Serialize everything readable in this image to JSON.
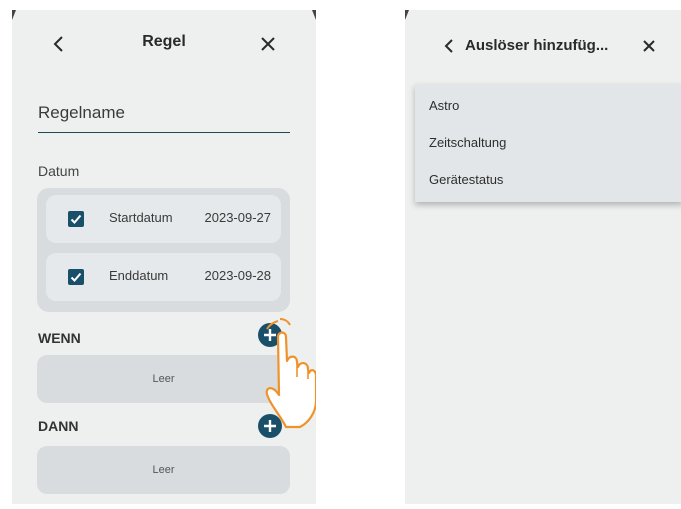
{
  "left_screen": {
    "title": "Regel",
    "rule_name_label": "Regelname",
    "date_section_label": "Datum",
    "start_date": {
      "label": "Startdatum",
      "value": "2023-09-27",
      "checked": true
    },
    "end_date": {
      "label": "Enddatum",
      "value": "2023-09-28",
      "checked": true
    },
    "when_label": "WENN",
    "when_empty": "Leer",
    "then_label": "DANN",
    "then_empty": "Leer",
    "icons": {
      "back": "chevron-left-icon",
      "close": "close-icon",
      "add": "plus-circle-icon",
      "check": "checkmark-icon",
      "tap_hand": "hand-pointer-icon"
    }
  },
  "right_screen": {
    "title": "Auslöser hinzufüg...",
    "menu_items": [
      "Astro",
      "Zeitschaltung",
      "Gerätestatus"
    ],
    "icons": {
      "back": "chevron-left-icon",
      "close": "close-icon"
    }
  },
  "colors": {
    "accent": "#1a4f6a",
    "screen_background": "#eef0f0",
    "panel_background": "#d9dcdf",
    "hand_outline": "#f0922b"
  }
}
